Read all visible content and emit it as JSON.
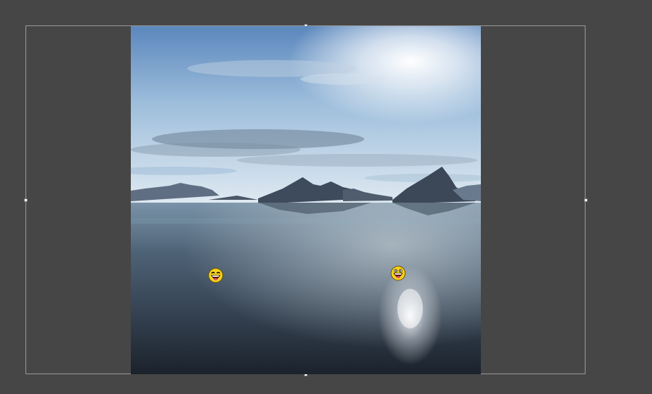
{
  "editor": {
    "canvas_background": "#464646",
    "selection_frame_color": "#9a9a9a"
  },
  "image": {
    "subject": "seascape",
    "sky_colors": [
      "#5b87bd",
      "#9fbfdc",
      "#e7eef4"
    ],
    "mountain_color": "#3e4b5c",
    "water_colors": [
      "#6f8aa1",
      "#3a4c5e",
      "#1e2631"
    ],
    "sun_glint_color": "#ffffff"
  },
  "stickers": [
    {
      "name": "awesome-face-sticker-left",
      "icon": "laughing-face-icon",
      "color": "#f7d21b"
    },
    {
      "name": "awesome-face-sticker-right",
      "icon": "laughing-face-icon",
      "color": "#f7d21b"
    }
  ]
}
